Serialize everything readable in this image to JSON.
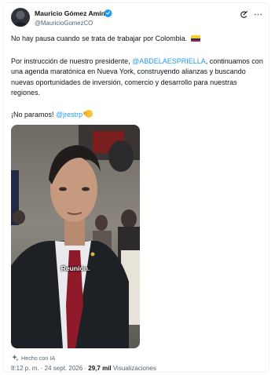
{
  "author": {
    "name": "Mauricio Gómez Amín",
    "handle": "@MauricioGomezCO"
  },
  "post": {
    "line1": "No hay pausa cuando se trata de trabajar por Colombia.",
    "line2_prefix": "Por instrucción de nuestro presidente, ",
    "line2_mention": "@ABDELAESPRIELLA",
    "line2_suffix": ", continuamos con una agenda maratónica en Nueva York, construyendo alianzas y buscando nuevas oportunidades de inversión, comercio y desarrollo para nuestras regiones.",
    "line3_prefix": "¡No paramos! ",
    "line3_mention": "@jrestrp"
  },
  "media": {
    "caption": "Reunión."
  },
  "ai_label": "Hecho con IA",
  "meta": {
    "timestamp": "8:12 p. m. · 24 sept. 2026 · ",
    "views_count": "29,7 mil",
    "views_label": " Visualizaciones"
  },
  "colors": {
    "accent": "#1d9bf0",
    "text": "#0f1419",
    "secondary": "#536471"
  },
  "icons": [
    "verified-badge-icon",
    "grok-icon",
    "more-icon",
    "flag-colombia-icon",
    "emoji-icon",
    "ai-sparkle-icon"
  ]
}
